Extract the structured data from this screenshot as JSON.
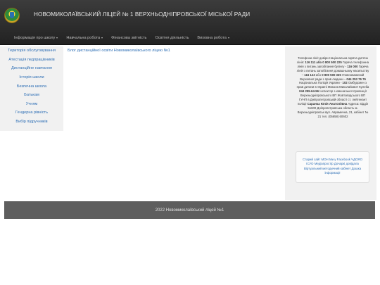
{
  "header": {
    "logo_icon": "school-emblem-icon",
    "title": "НОВОМИКОЛАЇВСЬКИЙ ЛІЦЕЙ № 1 ВЕРХНЬОДНІПРОВСЬКОЇ МІСЬКОЇ РАДИ"
  },
  "nav": {
    "items": [
      {
        "label": "Інформація про школу",
        "dropdown": true
      },
      {
        "label": "Навчальна робота",
        "dropdown": true
      },
      {
        "label": "Фінансова звітність",
        "dropdown": false
      },
      {
        "label": "Освітня діяльність",
        "dropdown": false
      },
      {
        "label": "Виховна робота",
        "dropdown": true
      }
    ]
  },
  "sidebar": {
    "items": [
      {
        "label": "Територія обслуговування"
      },
      {
        "label": "Атестація педпрацівників"
      },
      {
        "label": "Дистанційне навчання"
      },
      {
        "label": "Історія школи"
      },
      {
        "label": "Безпечна школа"
      },
      {
        "label": "Батькам"
      },
      {
        "label": "Учням"
      },
      {
        "label": "Гендерна рівність"
      },
      {
        "label": "Вибір підручників"
      }
    ]
  },
  "main": {
    "blog_link": "Блог дистанційної освіти Новомиколаївського ліцею №1"
  },
  "info": {
    "t1": "Телефони лінії довіри Національна гаряча дитяча лінія:",
    "p1": "116 111 або 0 800 500 225",
    "t2": "Гаряча телефонна лінія з питань запобігання булінгу -",
    "p2": "116 000",
    "t3": "Гаряча лінія з питань запобігання домашньому насильству –",
    "p3": "116 123",
    "t4": "або",
    "p4": "0 800 500 335",
    "t5": "Уповноважений Верховної ради з прав людини –",
    "p5": "044 253 76 76",
    "t6": "Національна Поліція України -",
    "p6": "102",
    "t7": "Омбудсмен з прав дитини в Україні Микола Миколайович Кулеба",
    "p7": "044 255-64-56",
    "t8": "Інспектор з ювенальної превенції Верхньодніпровського ВП Жовтоводського ВП ГУНП в Дніпропетровській області ст. лейтенант поліції",
    "p8": "Саранча Юлія Анатоліївна",
    "t9": "Адреса: відділ 51600 Дніпропетровська область м. Верхньодніпровськ вул. Аврамична, 21, кабінет № 21 тел. (05658) 60602"
  },
  "links": {
    "l1": "Старий сайт МОН",
    "l2": "Ми у Facebook",
    "l3": "ЧДОЯО",
    "l4": "ІСУО",
    "l5": "Медіапростір",
    "l6": "Дочаркі",
    "l7": "довідала",
    "l8": "Віртуальний методичний кабінет",
    "l9": "Дошка інформації"
  },
  "footer": {
    "text": "2022 Новомиколаївський ліцей №1"
  }
}
